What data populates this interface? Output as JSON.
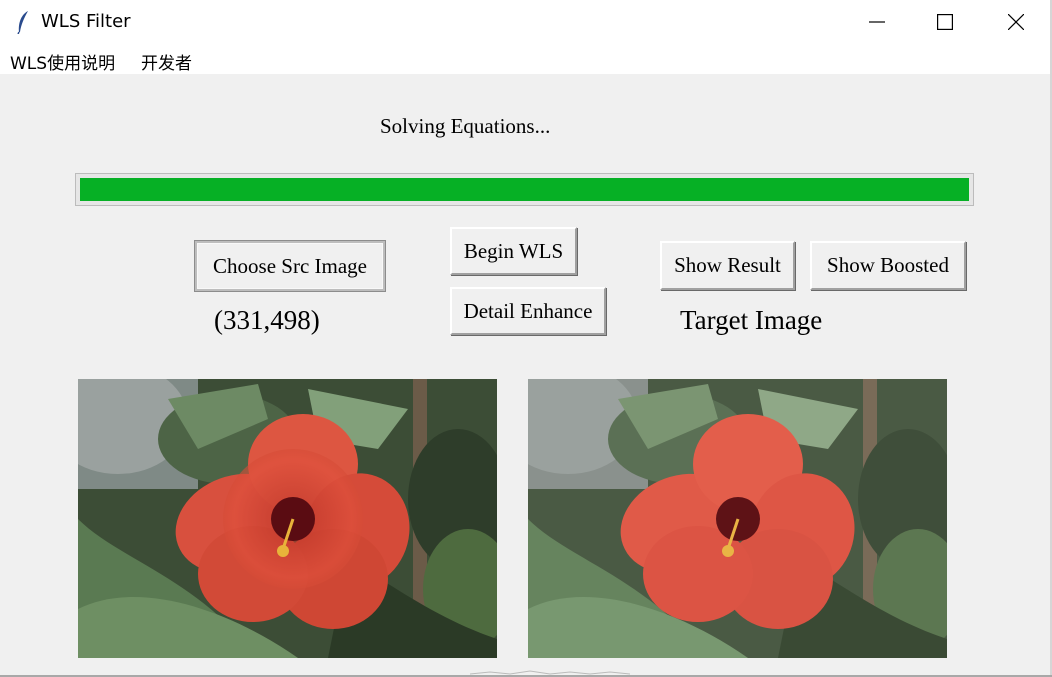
{
  "window": {
    "title": "WLS Filter",
    "controls": {
      "minimize_icon": "minimize-icon",
      "maximize_icon": "maximize-icon",
      "close_icon": "close-icon"
    }
  },
  "menu": {
    "items": [
      {
        "label": "WLS使用说明"
      },
      {
        "label": "开发者"
      }
    ]
  },
  "status": {
    "text": "Solving Equations..."
  },
  "progress": {
    "value_percent": 100,
    "color": "#06b025"
  },
  "buttons": {
    "choose_src": "Choose Src Image",
    "begin_wls": "Begin WLS",
    "detail_enhance": "Detail Enhance",
    "show_result": "Show Result",
    "show_boosted": "Show Boosted"
  },
  "labels": {
    "image_size": "(331,498)",
    "target": "Target Image"
  },
  "images": {
    "source": {
      "subject": "red hibiscus flower with green leaves"
    },
    "target": {
      "subject": "smoothed red hibiscus flower with green leaves"
    }
  }
}
